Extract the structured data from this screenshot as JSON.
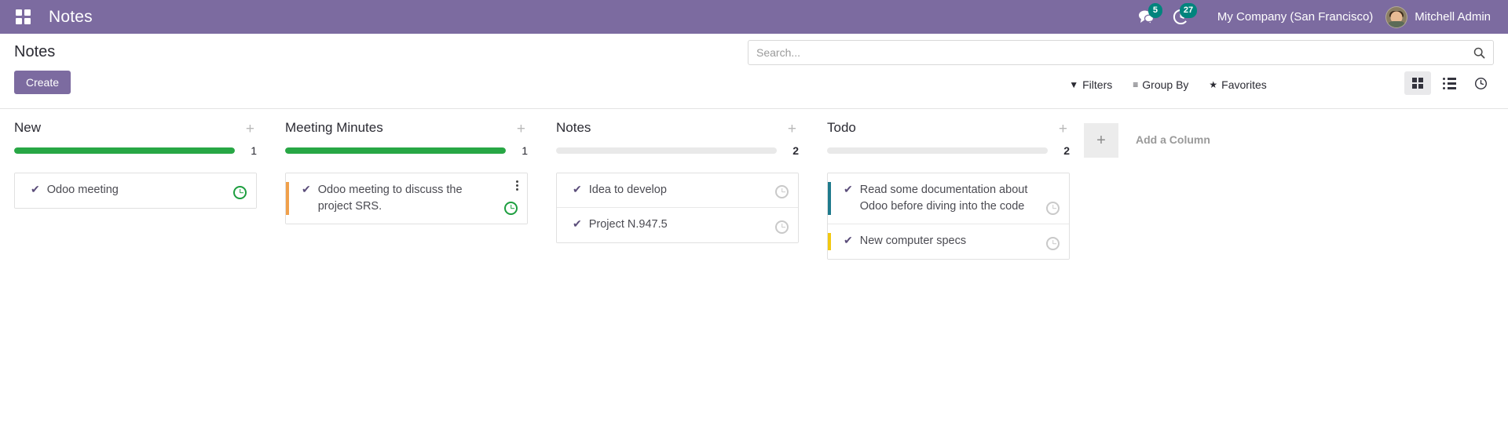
{
  "navbar": {
    "apps_icon": "apps-grid-icon",
    "brand": "Notes",
    "messages_icon": "chat-bubble-icon",
    "messages_count": "5",
    "activity_icon": "clock-activity-icon",
    "activity_count": "27",
    "company": "My Company (San Francisco)",
    "user": "Mitchell Admin",
    "bg_color": "#7C6BA0"
  },
  "control_panel": {
    "breadcrumb": "Notes",
    "create_label": "Create",
    "search": {
      "value": "",
      "placeholder": "Search...",
      "icon": "search-icon"
    },
    "filters": [
      {
        "label": "Filters",
        "icon": "funnel-icon",
        "glyph": "▼"
      },
      {
        "label": "Group By",
        "icon": "hamburger-icon",
        "glyph": "≡"
      },
      {
        "label": "Favorites",
        "icon": "star-icon",
        "glyph": "★"
      }
    ],
    "views": [
      {
        "name": "kanban",
        "icon": "kanban-grid-icon",
        "active": true
      },
      {
        "name": "list",
        "icon": "list-icon",
        "active": false
      },
      {
        "name": "activity",
        "icon": "clock-icon",
        "active": false
      }
    ]
  },
  "kanban": {
    "add_column_label": "Add a Column",
    "add_column_icon": "plus-icon",
    "columns": [
      {
        "title": "New",
        "count": "1",
        "count_bold": false,
        "progress_fill_percent": 100,
        "progress_color": "#28a745",
        "cards": [
          {
            "text": "Odoo meeting",
            "stripe_color": "",
            "activity_state": "green",
            "kebab": false
          }
        ]
      },
      {
        "title": "Meeting Minutes",
        "count": "1",
        "count_bold": false,
        "progress_fill_percent": 100,
        "progress_color": "#28a745",
        "cards": [
          {
            "text": "Odoo meeting to discuss the project SRS.",
            "stripe_color": "#f0a04b",
            "activity_state": "green",
            "kebab": true
          }
        ]
      },
      {
        "title": "Notes",
        "count": "2",
        "count_bold": true,
        "progress_fill_percent": 0,
        "progress_color": "#e9e9e9",
        "cards": [
          {
            "text": "Idea to develop",
            "stripe_color": "",
            "activity_state": "grey",
            "kebab": false
          },
          {
            "text": "Project N.947.5",
            "stripe_color": "",
            "activity_state": "grey",
            "kebab": false
          }
        ]
      },
      {
        "title": "Todo",
        "count": "2",
        "count_bold": true,
        "progress_fill_percent": 0,
        "progress_color": "#e9e9e9",
        "cards": [
          {
            "text": "Read some documentation about Odoo before diving into the code",
            "stripe_color": "#1f7a8c",
            "activity_state": "grey",
            "kebab": false
          },
          {
            "text": "New computer specs",
            "stripe_color": "#f2c811",
            "activity_state": "grey",
            "kebab": false
          }
        ]
      }
    ]
  }
}
